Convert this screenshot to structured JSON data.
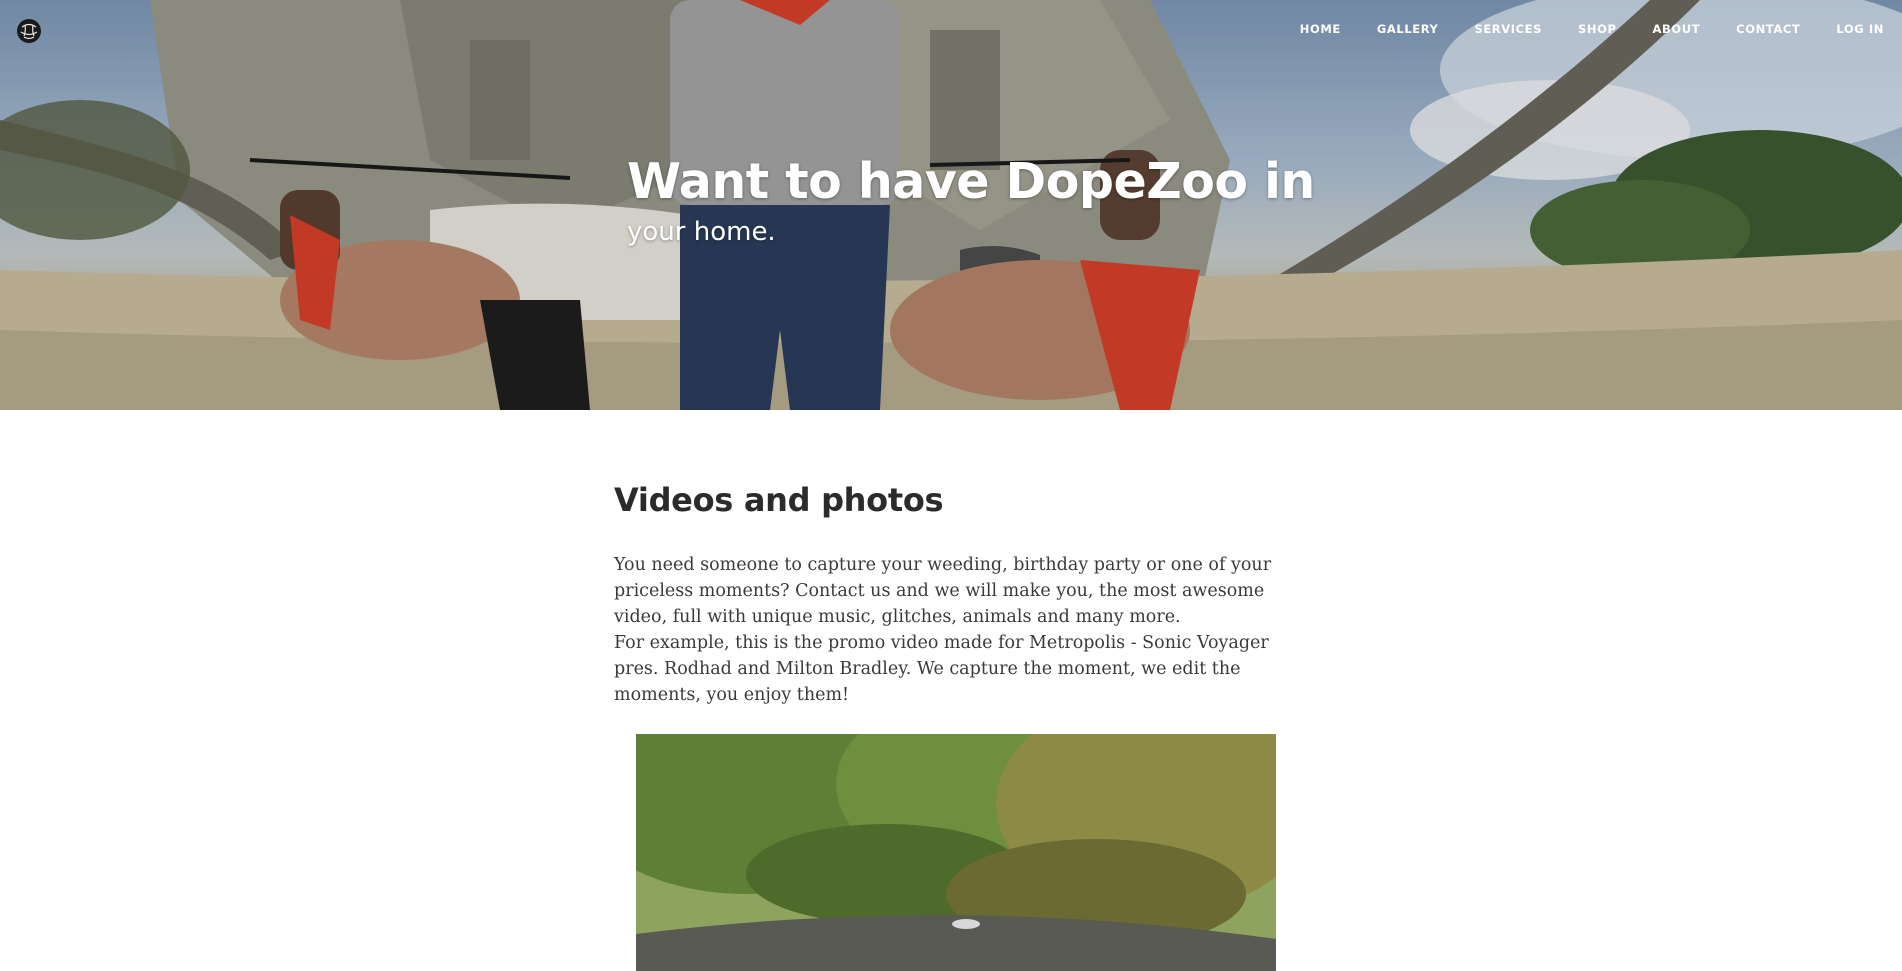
{
  "nav": {
    "items": [
      {
        "label": "HOME"
      },
      {
        "label": "GALLERY"
      },
      {
        "label": "SERVICES"
      },
      {
        "label": "SHOP"
      },
      {
        "label": "ABOUT"
      },
      {
        "label": "CONTACT"
      },
      {
        "label": "LOG IN"
      }
    ]
  },
  "hero": {
    "title": "Want to have DopeZoo in",
    "subtitle": "your home."
  },
  "section": {
    "heading": "Videos and photos",
    "paragraph1": "You need someone to capture your weeding, birthday party or one of your priceless moments? Contact us and we will make you, the most awesome video, full with unique music, glitches, animals and many more.",
    "paragraph2": "For example, this is the promo video made for Metropolis - Sonic Voyager pres. Rodhad and Milton Bradley. We capture the moment, we edit the moments, you enjoy them!"
  },
  "colors": {
    "text": "#2b2b2b",
    "nav_text": "#ffffff",
    "background": "#ffffff"
  },
  "icons": {
    "logo": "dopezoo-logo-icon"
  }
}
